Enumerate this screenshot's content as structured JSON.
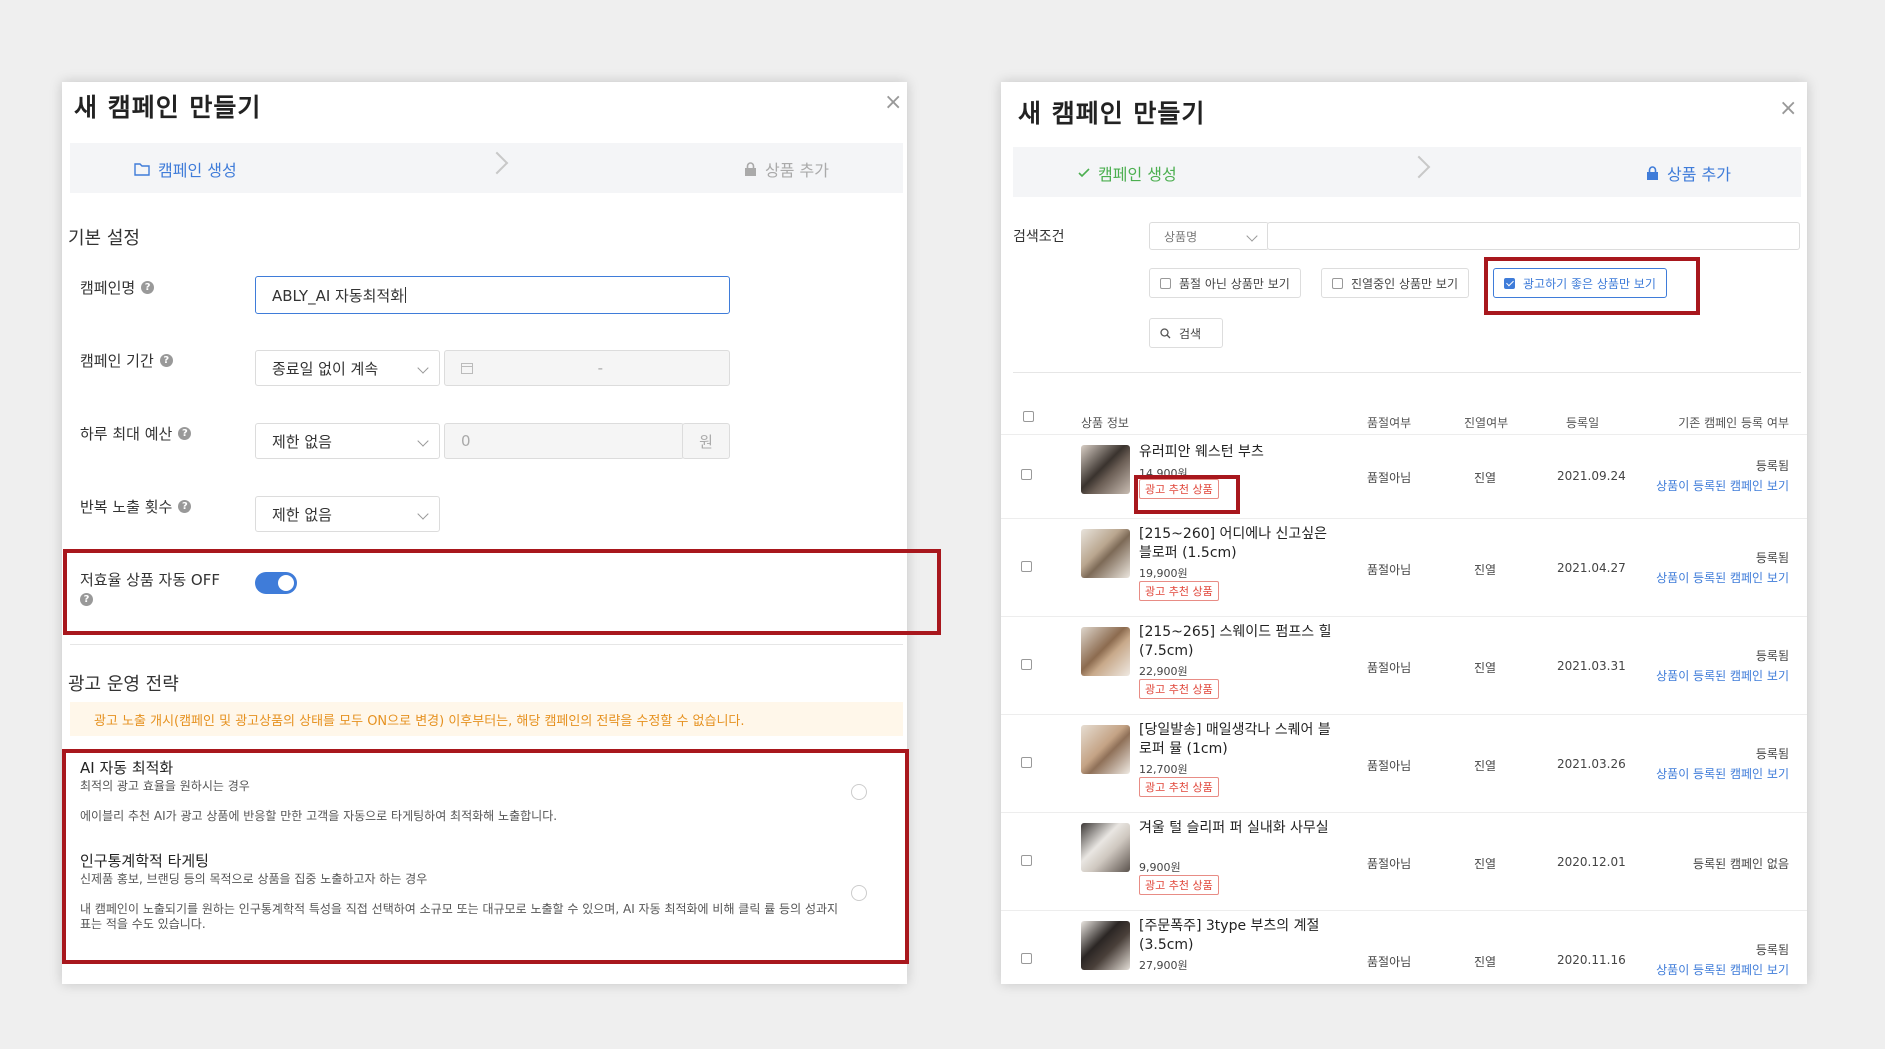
{
  "left": {
    "title": "새 캠페인 만들기",
    "close": "×",
    "steps": [
      {
        "label": "캠페인 생성",
        "icon": "folder-icon",
        "active": true
      },
      {
        "label": "상품 추가",
        "icon": "lock-icon",
        "active": false
      }
    ],
    "basic_title": "기본 설정",
    "fields": {
      "name_label": "캠페인명",
      "name_value": "ABLY_AI 자동최적화",
      "period_label": "캠페인 기간",
      "period_value": "종료일 없이 계속",
      "period_date_sep": "-",
      "budget_label": "하루 최대 예산",
      "budget_value": "제한 없음",
      "budget_amount": "0",
      "budget_unit": "원",
      "repeat_label": "반복 노출 횟수",
      "repeat_value": "제한 없음",
      "auto_off_label": "저효율 상품 자동 OFF",
      "auto_off_on": true
    },
    "strategy_title": "광고 운영 전략",
    "notice": "광고 노출 개시(캠페인 및 광고상품의 상태를 모두 ON으로 변경) 이후부터는, 해당 캠페인의 전략을 수정할 수 없습니다.",
    "strategies": [
      {
        "title": "AI 자동 최적화",
        "subtitle": "최적의 광고 효율을 원하시는 경우",
        "desc": "에이블리 추천 AI가 광고 상품에 반응할 만한 고객을 자동으로 타게팅하여 최적화해 노출합니다."
      },
      {
        "title": "인구통계학적 타게팅",
        "subtitle": "신제품 홍보, 브랜딩 등의 목적으로 상품을 집중 노출하고자 하는 경우",
        "desc": "내 캠페인이 노출되기를 원하는 인구통계학적 특성을 직접 선택하여 소규모 또는 대규모로 노출할 수 있으며, AI 자동 최적화에 비해 클릭 률 등의 성과지표는 적을 수도 있습니다."
      }
    ]
  },
  "right": {
    "title": "새 캠페인 만들기",
    "close": "×",
    "steps": [
      {
        "label": "캠페인 생성",
        "icon": "check-icon",
        "state": "done"
      },
      {
        "label": "상품 추가",
        "icon": "lock-icon",
        "state": "active"
      }
    ],
    "search_label": "검색조건",
    "search_select": "상품명",
    "filters": [
      {
        "label": "품절 아닌 상품만 보기",
        "checked": false
      },
      {
        "label": "진열중인 상품만 보기",
        "checked": false
      },
      {
        "label": "광고하기 좋은 상품만 보기",
        "checked": true
      }
    ],
    "search_button": "검색",
    "columns": [
      "상품 정보",
      "품절여부",
      "진열여부",
      "등록일",
      "기존 캠페인 등록 여부"
    ],
    "badge_label": "광고 추천 상품",
    "rows": [
      {
        "name": "유러피안 웨스턴 부츠",
        "price": "14,900원",
        "soldout": "품절아님",
        "display": "진열",
        "date": "2021.09.24",
        "reg": "등록됨",
        "link": "상품이 등록된 캠페인 보기"
      },
      {
        "name": "[215~260] 어디에나 신고싶은 블로퍼 (1.5cm)",
        "price": "19,900원",
        "soldout": "품절아님",
        "display": "진열",
        "date": "2021.04.27",
        "reg": "등록됨",
        "link": "상품이 등록된 캠페인 보기"
      },
      {
        "name": "[215~265] 스웨이드 펌프스 힐 (7.5cm)",
        "price": "22,900원",
        "soldout": "품절아님",
        "display": "진열",
        "date": "2021.03.31",
        "reg": "등록됨",
        "link": "상품이 등록된 캠페인 보기"
      },
      {
        "name": "[당일발송] 매일생각나 스퀘어 블로퍼 뮬 (1cm)",
        "price": "12,700원",
        "soldout": "품절아님",
        "display": "진열",
        "date": "2021.03.26",
        "reg": "등록됨",
        "link": "상품이 등록된 캠페인 보기"
      },
      {
        "name": "겨울 털 슬리퍼 퍼 실내화 사무실",
        "price": "9,900원",
        "soldout": "품절아님",
        "display": "진열",
        "date": "2020.12.01",
        "reg": "등록된 캠페인 없음",
        "link": ""
      },
      {
        "name": "[주문폭주] 3type 부츠의 계절 (3.5cm)",
        "price": "27,900원",
        "soldout": "품절아님",
        "display": "진열",
        "date": "2020.11.16",
        "reg": "등록됨",
        "link": "상품이 등록된 캠페인 보기"
      }
    ]
  },
  "colors": {
    "accent": "#3f7cd9",
    "highlight_red": "#a8171d",
    "notice_text": "#e69221",
    "badge_red": "#e0463a",
    "done_green": "#4caf50"
  }
}
